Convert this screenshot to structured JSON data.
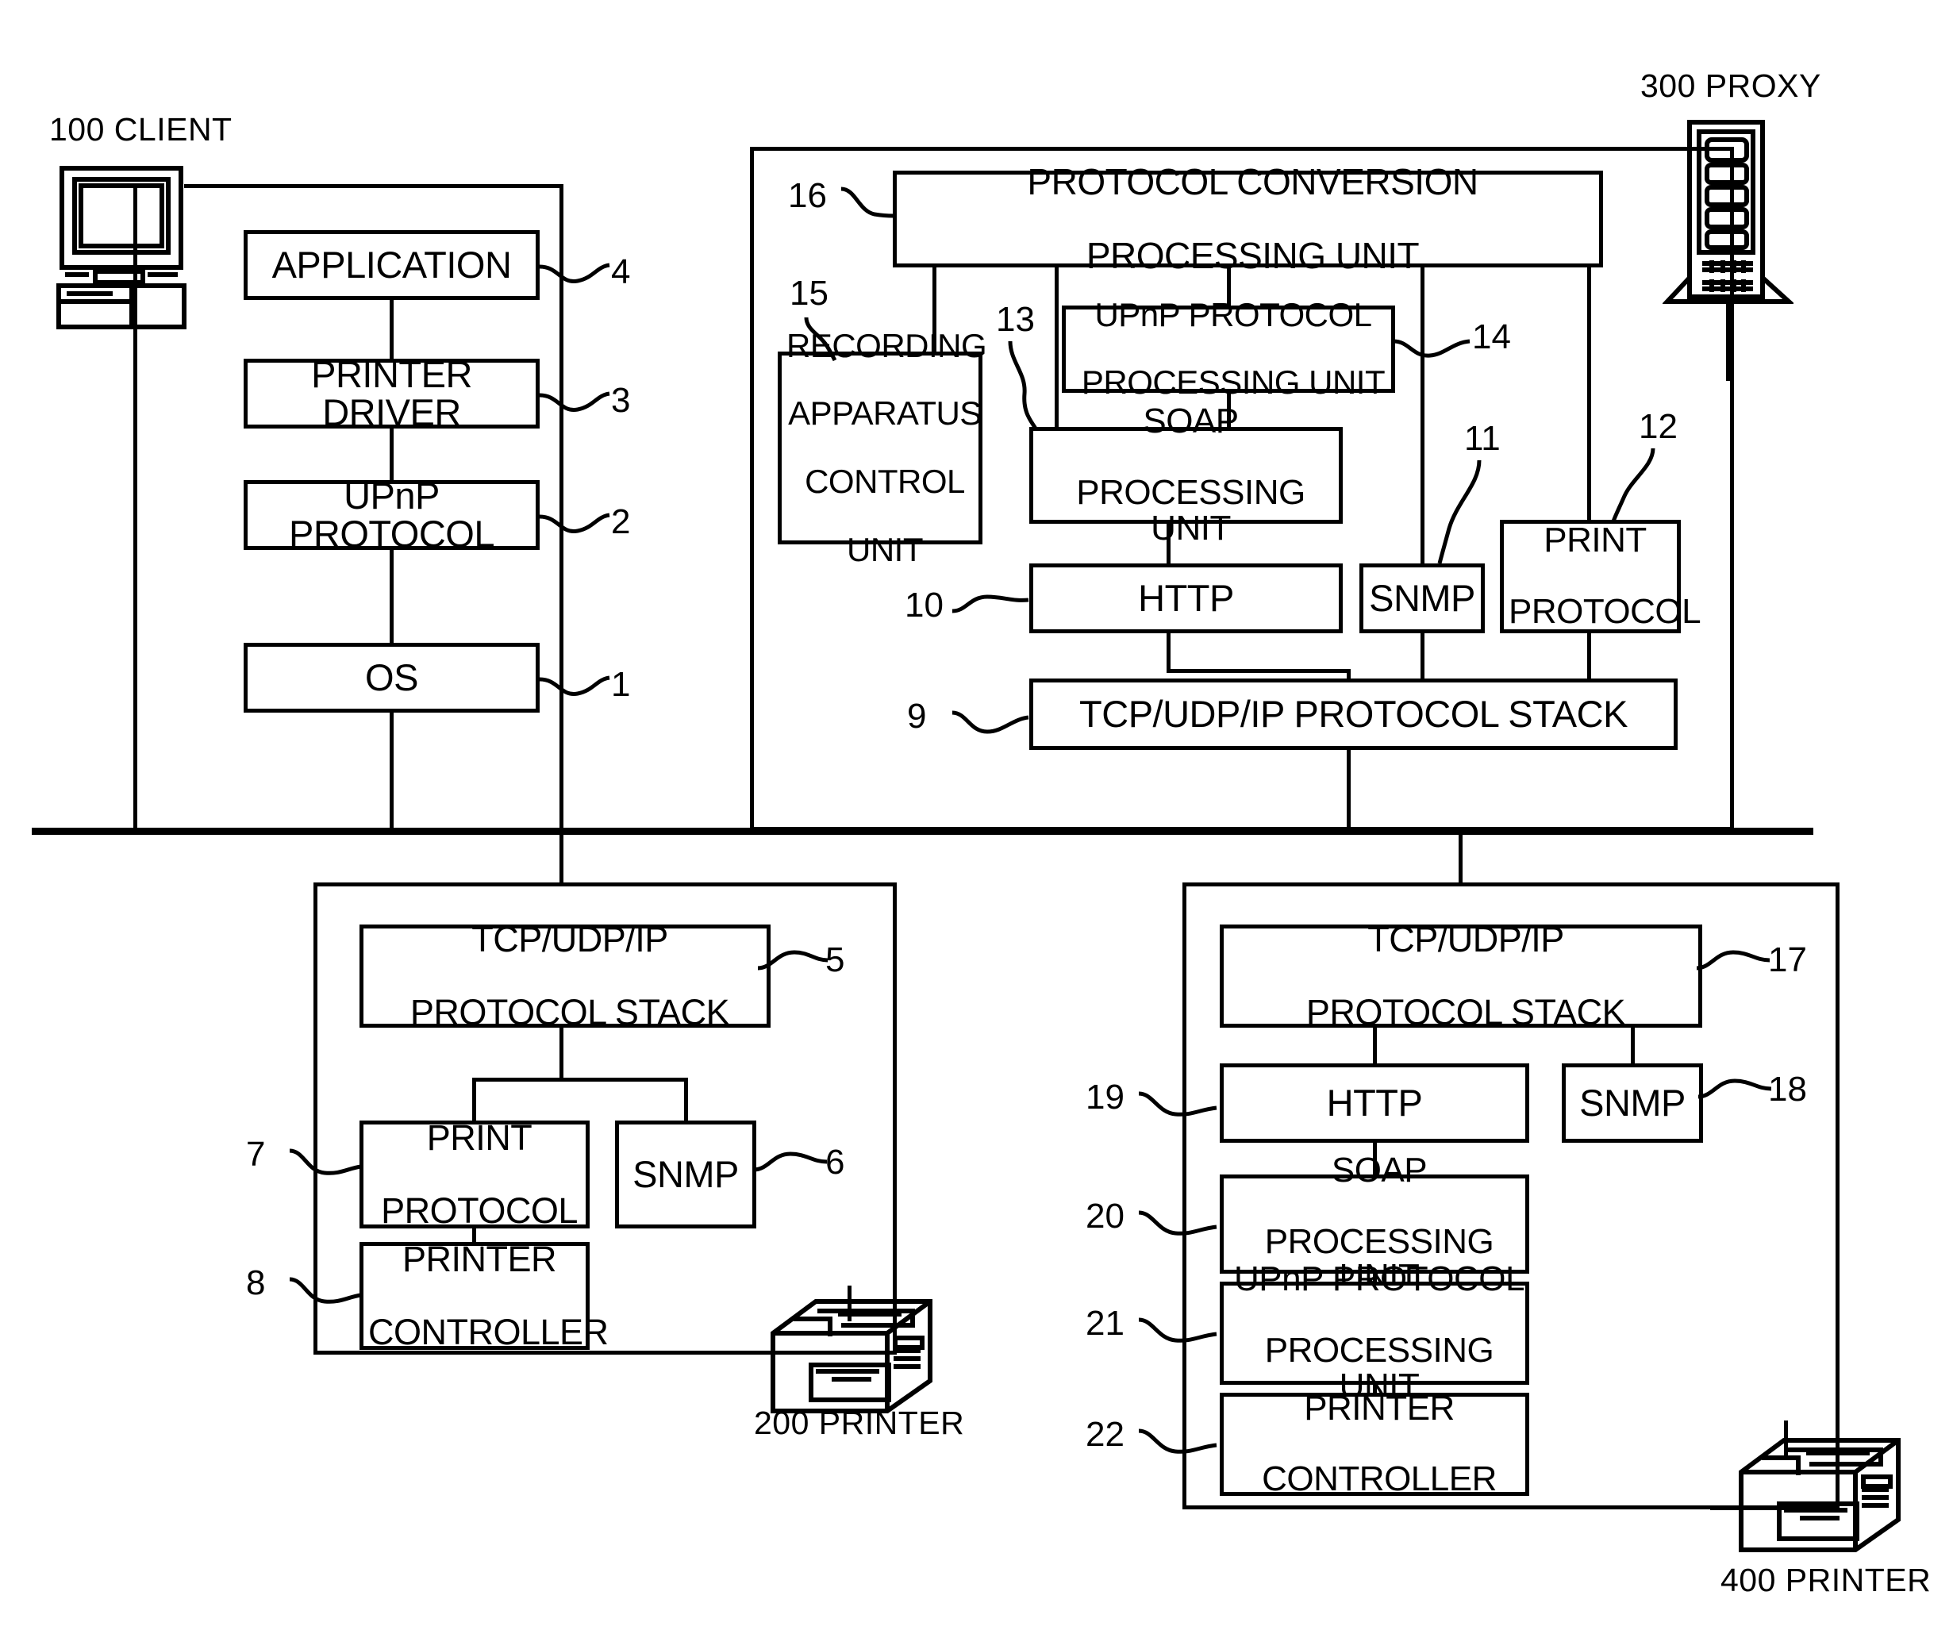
{
  "figure": {
    "type": "system-block-diagram",
    "line_color": "#000000",
    "background_color": "#ffffff"
  },
  "nodes": {
    "client_caption": "100 CLIENT",
    "proxy_caption": "300 PROXY",
    "printer200_caption": "200 PRINTER",
    "printer400_caption": "400 PRINTER"
  },
  "client": {
    "blocks": [
      {
        "ref": "4",
        "label": "APPLICATION"
      },
      {
        "ref": "3",
        "label": "PRINTER DRIVER"
      },
      {
        "ref": "2",
        "label": "UPnP PROTOCOL"
      },
      {
        "ref": "1",
        "label": "OS"
      }
    ]
  },
  "proxy": {
    "blocks": [
      {
        "ref": "16",
        "label_line1": "PROTOCOL CONVERSION",
        "label_line2": "PROCESSING UNIT"
      },
      {
        "ref": "15",
        "label_line1": "RECORDING",
        "label_line2": "APPARATUS",
        "label_line3": "CONTROL",
        "label_line4": "UNIT"
      },
      {
        "ref": "14",
        "label_line1": "UPnP PROTOCOL",
        "label_line2": "PROCESSING UNIT"
      },
      {
        "ref": "13",
        "label_line1": "SOAP",
        "label_line2": "PROCESSING UNIT"
      },
      {
        "ref": "10",
        "label": "HTTP"
      },
      {
        "ref": "11",
        "label": "SNMP"
      },
      {
        "ref": "12",
        "label_line1": "PRINT",
        "label_line2": "PROTOCOL"
      },
      {
        "ref": "9",
        "label": "TCP/UDP/IP PROTOCOL STACK"
      }
    ]
  },
  "printer200": {
    "blocks": [
      {
        "ref": "5",
        "label_line1": "TCP/UDP/IP",
        "label_line2": "PROTOCOL STACK"
      },
      {
        "ref": "7",
        "label_line1": "PRINT",
        "label_line2": "PROTOCOL"
      },
      {
        "ref": "6",
        "label": "SNMP"
      },
      {
        "ref": "8",
        "label_line1": "PRINTER",
        "label_line2": "CONTROLLER"
      }
    ]
  },
  "printer400": {
    "blocks": [
      {
        "ref": "17",
        "label_line1": "TCP/UDP/IP",
        "label_line2": "PROTOCOL STACK"
      },
      {
        "ref": "19",
        "label": "HTTP"
      },
      {
        "ref": "18",
        "label": "SNMP"
      },
      {
        "ref": "20",
        "label_line1": "SOAP",
        "label_line2": "PROCESSING UNIT"
      },
      {
        "ref": "21",
        "label_line1": "UPnP PROTOCOL",
        "label_line2": "PROCESSING UNIT"
      },
      {
        "ref": "22",
        "label_line1": "PRINTER",
        "label_line2": "CONTROLLER"
      }
    ]
  },
  "icons": {
    "client_computer": "desktop-computer-icon",
    "proxy_server": "server-tower-icon",
    "printer_200": "printer-icon",
    "printer_400": "printer-icon"
  }
}
